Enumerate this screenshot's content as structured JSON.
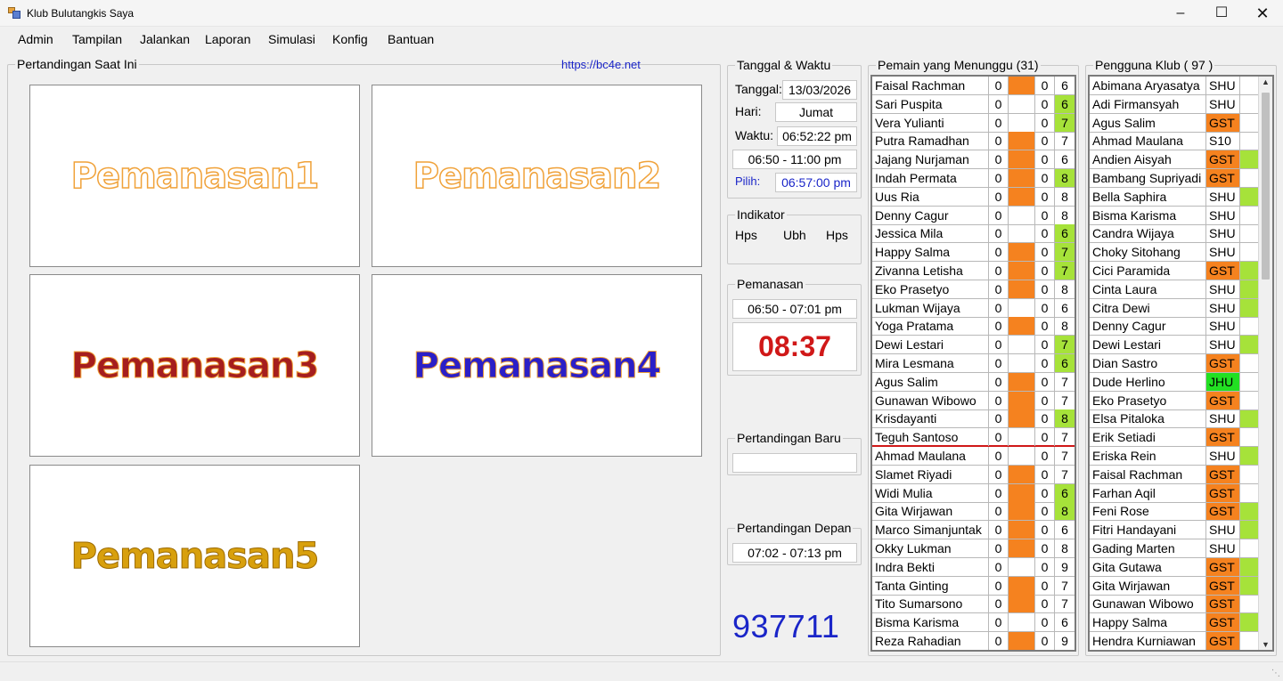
{
  "window": {
    "title": "Klub Bulutangkis Saya"
  },
  "menu": [
    "Admin",
    "Tampilan",
    "Jalankan",
    "Laporan",
    "Simulasi",
    "Konfig",
    "Bantuan"
  ],
  "current_matches": {
    "title": "Pertandingan Saat Ini",
    "url": "https://bc4e.net",
    "courts": [
      "Pemanasan1",
      "Pemanasan2",
      "Pemanasan3",
      "Pemanasan4",
      "Pemanasan5"
    ]
  },
  "datetime": {
    "title": "Tanggal & Waktu",
    "date_label": "Tanggal:",
    "date": "13/03/2026",
    "day_label": "Hari:",
    "day": "Jumat",
    "time_label": "Waktu:",
    "time": "06:52:22 pm",
    "session": "06:50 - 11:00 pm",
    "pick_label": "Pilih:",
    "pick": "06:57:00 pm"
  },
  "indicator": {
    "title": "Indikator",
    "items": [
      "Hps",
      "Ubh",
      "Hps"
    ]
  },
  "warmup": {
    "title": "Pemanasan",
    "range": "06:50 - 07:01 pm",
    "countdown": "08:37"
  },
  "new_match": {
    "title": "Pertandingan Baru",
    "value": ""
  },
  "next_match": {
    "title": "Pertandingan Depan",
    "range": "07:02 - 07:13 pm"
  },
  "counter": "937711",
  "waiting": {
    "title": "Pemain yang Menunggu (31)",
    "rows": [
      {
        "name": "Faisal Rachman",
        "a": "0",
        "status": "orange",
        "b": "0",
        "c": "6",
        "hl": ""
      },
      {
        "name": "Sari Puspita",
        "a": "0",
        "status": "",
        "b": "0",
        "c": "6",
        "hl": "green"
      },
      {
        "name": "Vera Yulianti",
        "a": "0",
        "status": "",
        "b": "0",
        "c": "7",
        "hl": "green"
      },
      {
        "name": "Putra Ramadhan",
        "a": "0",
        "status": "orange",
        "b": "0",
        "c": "7",
        "hl": ""
      },
      {
        "name": "Jajang Nurjaman",
        "a": "0",
        "status": "orange",
        "b": "0",
        "c": "6",
        "hl": ""
      },
      {
        "name": "Indah Permata",
        "a": "0",
        "status": "orange",
        "b": "0",
        "c": "8",
        "hl": "green"
      },
      {
        "name": "Uus Ria",
        "a": "0",
        "status": "orange",
        "b": "0",
        "c": "8",
        "hl": ""
      },
      {
        "name": "Denny Cagur",
        "a": "0",
        "status": "",
        "b": "0",
        "c": "8",
        "hl": ""
      },
      {
        "name": "Jessica Mila",
        "a": "0",
        "status": "",
        "b": "0",
        "c": "6",
        "hl": "green"
      },
      {
        "name": "Happy Salma",
        "a": "0",
        "status": "orange",
        "b": "0",
        "c": "7",
        "hl": "green"
      },
      {
        "name": "Zivanna Letisha",
        "a": "0",
        "status": "orange",
        "b": "0",
        "c": "7",
        "hl": "green"
      },
      {
        "name": "Eko Prasetyo",
        "a": "0",
        "status": "orange",
        "b": "0",
        "c": "8",
        "hl": ""
      },
      {
        "name": "Lukman Wijaya",
        "a": "0",
        "status": "",
        "b": "0",
        "c": "6",
        "hl": ""
      },
      {
        "name": "Yoga Pratama",
        "a": "0",
        "status": "orange",
        "b": "0",
        "c": "8",
        "hl": ""
      },
      {
        "name": "Dewi Lestari",
        "a": "0",
        "status": "",
        "b": "0",
        "c": "7",
        "hl": "green"
      },
      {
        "name": "Mira Lesmana",
        "a": "0",
        "status": "",
        "b": "0",
        "c": "6",
        "hl": "green"
      },
      {
        "name": "Agus Salim",
        "a": "0",
        "status": "orange",
        "b": "0",
        "c": "7",
        "hl": ""
      },
      {
        "name": "Gunawan Wibowo",
        "a": "0",
        "status": "orange",
        "b": "0",
        "c": "7",
        "hl": ""
      },
      {
        "name": "Krisdayanti",
        "a": "0",
        "status": "orange",
        "b": "0",
        "c": "8",
        "hl": "green"
      },
      {
        "name": "Teguh Santoso",
        "a": "0",
        "status": "",
        "b": "0",
        "c": "7",
        "hl": ""
      },
      {
        "name": "Ahmad Maulana",
        "a": "0",
        "status": "",
        "b": "0",
        "c": "7",
        "hl": ""
      },
      {
        "name": "Slamet Riyadi",
        "a": "0",
        "status": "orange",
        "b": "0",
        "c": "7",
        "hl": ""
      },
      {
        "name": "Widi Mulia",
        "a": "0",
        "status": "orange",
        "b": "0",
        "c": "6",
        "hl": "green"
      },
      {
        "name": "Gita Wirjawan",
        "a": "0",
        "status": "orange",
        "b": "0",
        "c": "8",
        "hl": "green"
      },
      {
        "name": "Marco Simanjuntak",
        "a": "0",
        "status": "orange",
        "b": "0",
        "c": "6",
        "hl": ""
      },
      {
        "name": "Okky Lukman",
        "a": "0",
        "status": "orange",
        "b": "0",
        "c": "8",
        "hl": ""
      },
      {
        "name": "Indra Bekti",
        "a": "0",
        "status": "",
        "b": "0",
        "c": "9",
        "hl": ""
      },
      {
        "name": "Tanta Ginting",
        "a": "0",
        "status": "orange",
        "b": "0",
        "c": "7",
        "hl": ""
      },
      {
        "name": "Tito Sumarsono",
        "a": "0",
        "status": "orange",
        "b": "0",
        "c": "7",
        "hl": ""
      },
      {
        "name": "Bisma Karisma",
        "a": "0",
        "status": "",
        "b": "0",
        "c": "6",
        "hl": ""
      },
      {
        "name": "Reza Rahadian",
        "a": "0",
        "status": "orange",
        "b": "0",
        "c": "9",
        "hl": ""
      }
    ]
  },
  "members": {
    "title": "Pengguna Klub ( 97 )",
    "rows": [
      {
        "name": "Abimana Aryasatya",
        "type": "SHU",
        "tc": "",
        "flag": ""
      },
      {
        "name": "Adi Firmansyah",
        "type": "SHU",
        "tc": "",
        "flag": ""
      },
      {
        "name": "Agus Salim",
        "type": "GST",
        "tc": "orange",
        "flag": ""
      },
      {
        "name": "Ahmad Maulana",
        "type": "S10",
        "tc": "",
        "flag": ""
      },
      {
        "name": "Andien Aisyah",
        "type": "GST",
        "tc": "orange",
        "flag": "green"
      },
      {
        "name": "Bambang Supriyadi",
        "type": "GST",
        "tc": "orange",
        "flag": ""
      },
      {
        "name": "Bella Saphira",
        "type": "SHU",
        "tc": "",
        "flag": "green"
      },
      {
        "name": "Bisma Karisma",
        "type": "SHU",
        "tc": "",
        "flag": ""
      },
      {
        "name": "Candra Wijaya",
        "type": "SHU",
        "tc": "",
        "flag": ""
      },
      {
        "name": "Choky Sitohang",
        "type": "SHU",
        "tc": "",
        "flag": ""
      },
      {
        "name": "Cici Paramida",
        "type": "GST",
        "tc": "orange",
        "flag": "green"
      },
      {
        "name": "Cinta Laura",
        "type": "SHU",
        "tc": "",
        "flag": "green"
      },
      {
        "name": "Citra Dewi",
        "type": "SHU",
        "tc": "",
        "flag": "green"
      },
      {
        "name": "Denny Cagur",
        "type": "SHU",
        "tc": "",
        "flag": ""
      },
      {
        "name": "Dewi Lestari",
        "type": "SHU",
        "tc": "",
        "flag": "green"
      },
      {
        "name": "Dian Sastro",
        "type": "GST",
        "tc": "orange",
        "flag": ""
      },
      {
        "name": "Dude Herlino",
        "type": "JHU",
        "tc": "lime",
        "flag": ""
      },
      {
        "name": "Eko Prasetyo",
        "type": "GST",
        "tc": "orange",
        "flag": ""
      },
      {
        "name": "Elsa Pitaloka",
        "type": "SHU",
        "tc": "",
        "flag": "green"
      },
      {
        "name": "Erik Setiadi",
        "type": "GST",
        "tc": "orange",
        "flag": ""
      },
      {
        "name": "Eriska Rein",
        "type": "SHU",
        "tc": "",
        "flag": "green"
      },
      {
        "name": "Faisal Rachman",
        "type": "GST",
        "tc": "orange",
        "flag": ""
      },
      {
        "name": "Farhan Aqil",
        "type": "GST",
        "tc": "orange",
        "flag": ""
      },
      {
        "name": "Feni Rose",
        "type": "GST",
        "tc": "orange",
        "flag": "green"
      },
      {
        "name": "Fitri Handayani",
        "type": "SHU",
        "tc": "",
        "flag": "green"
      },
      {
        "name": "Gading Marten",
        "type": "SHU",
        "tc": "",
        "flag": ""
      },
      {
        "name": "Gita Gutawa",
        "type": "GST",
        "tc": "orange",
        "flag": "green"
      },
      {
        "name": "Gita Wirjawan",
        "type": "GST",
        "tc": "orange",
        "flag": "green"
      },
      {
        "name": "Gunawan Wibowo",
        "type": "GST",
        "tc": "orange",
        "flag": ""
      },
      {
        "name": "Happy Salma",
        "type": "GST",
        "tc": "orange",
        "flag": "green"
      },
      {
        "name": "Hendra Kurniawan",
        "type": "GST",
        "tc": "orange",
        "flag": ""
      }
    ]
  }
}
